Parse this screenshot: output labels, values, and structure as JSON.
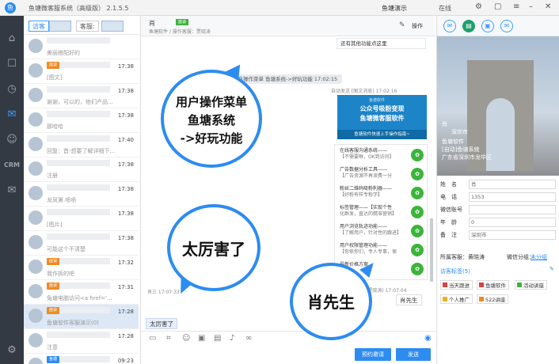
{
  "app": {
    "title": "鱼塘微客服系统（高级版） 2.1.5.5",
    "user": "鱼塘演示",
    "status": "在线"
  },
  "tabs": {
    "visitor": "访客",
    "customer": "客服:"
  },
  "sessions": [
    {
      "time": "",
      "msg": "美丽搭配好的"
    },
    {
      "time": "17:38",
      "badge": "面谈",
      "msg": "[图文]"
    },
    {
      "time": "17:38",
      "badge": "",
      "msg": "谢谢，可以的，他们产品..."
    },
    {
      "time": "17:38",
      "badge": "",
      "msg": "那哈哈"
    },
    {
      "time": "17:40",
      "badge": "",
      "msg": "回复：首-想要了解详细下..."
    },
    {
      "time": "17:38",
      "badge": "",
      "msg": "注册"
    },
    {
      "time": "17:38",
      "badge": "",
      "msg": "龙凤第.喷喷"
    },
    {
      "time": "17:38",
      "badge": "",
      "msg": "[图片]"
    },
    {
      "time": "17:38",
      "badge": "",
      "msg": "可能这个不清楚"
    },
    {
      "time": "17:32",
      "badge": "面谈",
      "msg": "我作拆的吧"
    },
    {
      "time": "17:31",
      "badge": "面谈",
      "msg": "兔塘电脑访问<a href='..."
    },
    {
      "time": "17:28",
      "badge": "面谈",
      "msg": "鱼塘软件客服演示(0)"
    },
    {
      "time": "17:28",
      "badge": "",
      "msg": "注意"
    },
    {
      "time": "09:23",
      "badge": "鱼塘",
      "msg": ""
    }
  ],
  "chat": {
    "name": "肖",
    "badge": "面谈",
    "sub": "鱼塘软件 / 操作客服：贾晓涛",
    "ops": "操作",
    "top_msg": "还有其他功能点这里",
    "system_line": "用户操作菜单 鱼塘系统->好玩功能  17:02:15",
    "promo_head": "自动发送 [图文消息]  17:02:16",
    "promo_logo": "鱼塘软件",
    "promo_line1": "公众号吸粉变现",
    "promo_line2": "鱼塘微客服软件",
    "promo_line3": "鱼塘软件快速上手操作指南~",
    "items": [
      {
        "title": "在线客服沟通系统——",
        "sub": "【不需要咻，OK到访问】"
      },
      {
        "title": "广告数据分析工具——",
        "sub": "【广告资源不再浪费一分"
      },
      {
        "title": "粉丝二维码吸粉利器——",
        "sub": "【好粉有样专粉学】"
      },
      {
        "title": "标签管理——【实现个性",
        "sub": "化群发，直达的精准营销】"
      },
      {
        "title": "用户浏览轨迹功能——",
        "sub": "【了解用户，针对性的跟进】"
      },
      {
        "title": "用户权限管理功能——",
        "sub": "【你依你们，专人专事，保"
      },
      {
        "title": "最新价格方案",
        "sub": ""
      }
    ],
    "agent_name": "操作客服(贾晓涛)  17:07:04",
    "agent_reply": "肖先生",
    "cust_time": "肖三  17:07:33",
    "cust_reply": "太厉害了",
    "btn_preset": "预约邀请",
    "btn_send": "发送"
  },
  "callouts": {
    "one_l1": "用户操作菜单",
    "one_l2": "鱼塘系统",
    "one_l3": "->好玩功能",
    "two": "太厉害了",
    "three": "肖先生"
  },
  "profile": {
    "name_label": "肖",
    "source": "深圳市",
    "source2": "鱼塘软件",
    "source3": "[自动]鱼塘系统",
    "location": "广东省深圳市龙华区",
    "fields": [
      {
        "label": "姓　名",
        "value": "肖"
      },
      {
        "label": "电　话",
        "value": "1353"
      },
      {
        "label": "微信账号",
        "value": ""
      },
      {
        "label": "年　龄",
        "value": "0"
      },
      {
        "label": "备　注",
        "value": "深圳市"
      }
    ],
    "owner": "所属客服：黄晓涛",
    "group": "微信分组：",
    "group_link": "未分组",
    "tag_title": "访客标签(5)",
    "tags": [
      {
        "label": "当天跟进",
        "color": "#e04040"
      },
      {
        "label": "鱼塘软件",
        "color": "#e04040"
      },
      {
        "label": "活动讲座",
        "color": "#3cb43c"
      },
      {
        "label": "个人推广",
        "color": "#f0b020"
      },
      {
        "label": "522讲座",
        "color": "#f08a24"
      }
    ]
  }
}
